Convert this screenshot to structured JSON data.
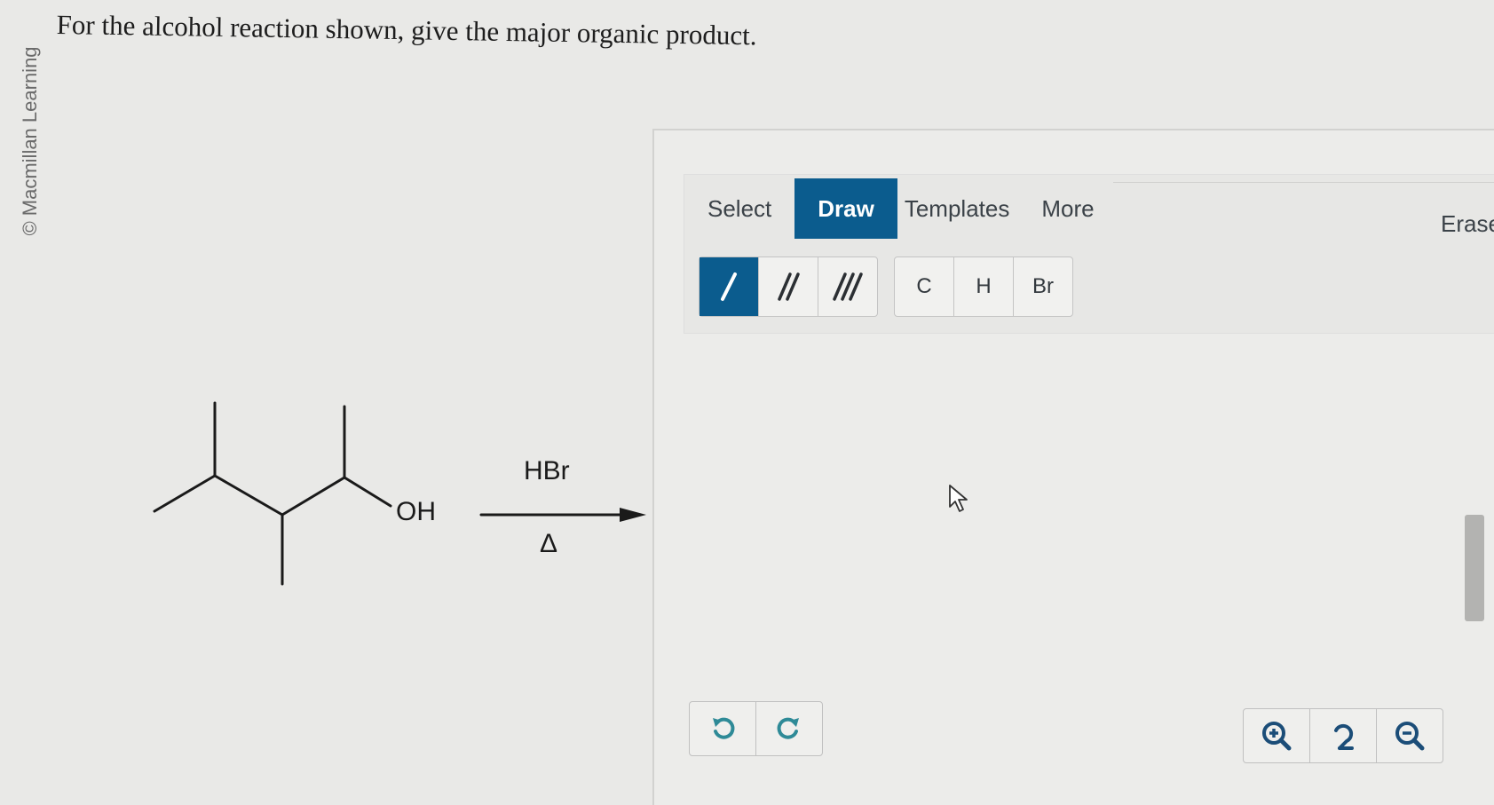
{
  "copyright": "© Macmillan Learning",
  "question": "For the alcohol reaction shown, give the major organic product.",
  "reaction": {
    "substituent": "OH",
    "reagent": "HBr",
    "condition": "Δ"
  },
  "toolbar": {
    "tabs": [
      {
        "label": "Select",
        "active": false
      },
      {
        "label": "Draw",
        "active": true
      },
      {
        "label": "Templates",
        "active": false
      },
      {
        "label": "More",
        "active": false
      }
    ],
    "erase_label": "Erase",
    "bond_tools": [
      {
        "name": "single-bond",
        "active": true
      },
      {
        "name": "double-bond",
        "active": false
      },
      {
        "name": "triple-bond",
        "active": false
      }
    ],
    "atoms": [
      "C",
      "H",
      "Br"
    ]
  },
  "history": [
    "undo-icon",
    "redo-icon"
  ],
  "zoom": [
    "zoom-in-icon",
    "zoom-reset-icon",
    "zoom-out-icon"
  ],
  "colors": {
    "accent": "#0b5c8e",
    "icon_teal": "#2e8a97",
    "icon_navy": "#1b4d78"
  }
}
